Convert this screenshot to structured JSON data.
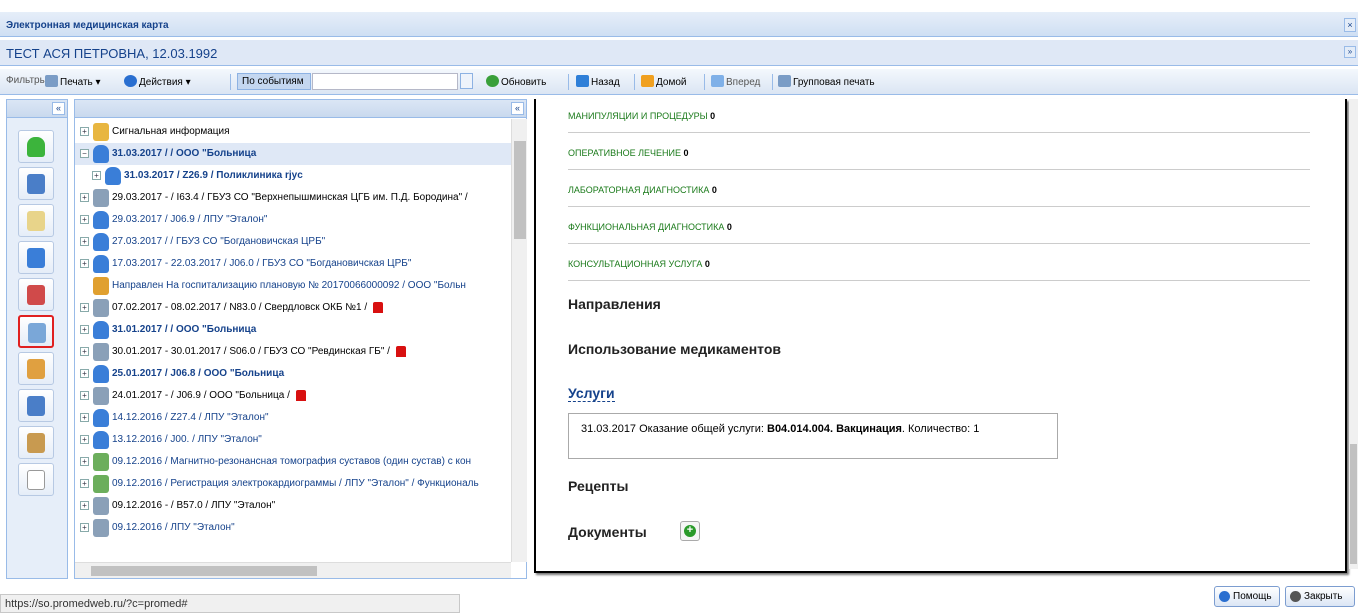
{
  "window": {
    "title": "Электронная медицинская карта",
    "close_glyph": "×"
  },
  "patient": {
    "name": "ТЕСТ АСЯ ПЕТРОВНА, 12.03.1992",
    "collapse_glyph": "»"
  },
  "toolbar": {
    "filters": "Фильтры",
    "print": "Печать ▾",
    "actions": "Действия ▾",
    "events": "По событиям",
    "search_value": "",
    "refresh": "Обновить",
    "back": "Назад",
    "home": "Домой",
    "forward": "Вперед",
    "group_print": "Групповая печать"
  },
  "leftbar": {
    "collapse_glyph": "«"
  },
  "tree": {
    "collapse_glyph": "«",
    "rows": [
      {
        "text": "Сигнальная информация",
        "style": "dark",
        "icon": "folder-info-icon",
        "color": "#e8b640"
      },
      {
        "text": "31.03.2017  /  / ООО \"Больница",
        "style": "bold",
        "icon": "person-icon",
        "color": "#3a7ed8",
        "selected": true,
        "expanded": true
      },
      {
        "text": "31.03.2017  / Z26.9  / Поликлиника rjyc",
        "style": "bold",
        "icon": "person-small-icon",
        "color": "#3a7ed8",
        "indent": true
      },
      {
        "text": "29.03.2017 - / I63.4 / ГБУЗ СО \"Верхнепышминская ЦГБ им. П.Д. Бородина\" /",
        "style": "dark",
        "icon": "ambulance-icon",
        "color": "#8aa0b8"
      },
      {
        "text": "29.03.2017  / J06.9  / ЛПУ \"Эталон\"",
        "style": "",
        "icon": "person-icon",
        "color": "#3a7ed8"
      },
      {
        "text": "27.03.2017  /  / ГБУЗ СО \"Богдановичская ЦРБ\"",
        "style": "",
        "icon": "person-icon",
        "color": "#3a7ed8"
      },
      {
        "text": "17.03.2017 - 22.03.2017  / J06.0  / ГБУЗ СО \"Богдановичская ЦРБ\"",
        "style": "",
        "icon": "person-icon",
        "color": "#3a7ed8"
      },
      {
        "text": "Направлен  На госпитализацию плановую  №  20170066000092  / ООО \"Больн",
        "style": "",
        "icon": "direction-icon",
        "color": "#e0a030",
        "nochild": true
      },
      {
        "text": "07.02.2017 - 08.02.2017 / N83.0 / Свердловск ОКБ №1 /",
        "style": "dark",
        "icon": "ambulance-icon",
        "color": "#8aa0b8",
        "flag": true
      },
      {
        "text": "31.01.2017  /  / ООО \"Больница",
        "style": "bold",
        "icon": "person-icon",
        "color": "#3a7ed8"
      },
      {
        "text": "30.01.2017 - 30.01.2017 / S06.0 / ГБУЗ СО \"Ревдинская ГБ\" /",
        "style": "dark",
        "icon": "ambulance-icon",
        "color": "#8aa0b8",
        "flag": true
      },
      {
        "text": "25.01.2017  / J06.8  / ООО \"Больница",
        "style": "bold",
        "icon": "person-icon",
        "color": "#3a7ed8"
      },
      {
        "text": "24.01.2017 - / J06.9 / ООО \"Больница /",
        "style": "dark",
        "icon": "ambulance-icon",
        "color": "#8aa0b8",
        "flag": true
      },
      {
        "text": "14.12.2016  / Z27.4  / ЛПУ \"Эталон\"",
        "style": "",
        "icon": "person-icon",
        "color": "#3a7ed8"
      },
      {
        "text": "13.12.2016  / J00.  / ЛПУ \"Эталон\"",
        "style": "",
        "icon": "person-icon",
        "color": "#3a7ed8"
      },
      {
        "text": "09.12.2016 / Магнитно-резонансная томография суставов (один сустав) с кон",
        "style": "",
        "icon": "document-icon",
        "color": "#6cae5c"
      },
      {
        "text": "09.12.2016 / Регистрация электрокардиограммы  / ЛПУ \"Эталон\" / Функциональ",
        "style": "",
        "icon": "document-icon",
        "color": "#6cae5c"
      },
      {
        "text": "09.12.2016 - / B57.0 / ЛПУ \"Эталон\"",
        "style": "dark",
        "icon": "ambulance-icon",
        "color": "#8aa0b8"
      },
      {
        "text": "09.12.2016  /  ЛПУ \"Эталон\"",
        "style": "",
        "icon": "ambulance-icon",
        "color": "#8aa0b8"
      }
    ]
  },
  "content": {
    "services": [
      {
        "label": "МАНИПУЛЯЦИИ И ПРОЦЕДУРЫ",
        "count": "0"
      },
      {
        "label": "ОПЕРАТИВНОЕ ЛЕЧЕНИЕ",
        "count": "0"
      },
      {
        "label": "ЛАБОРАТОРНАЯ ДИАГНОСТИКА",
        "count": "0"
      },
      {
        "label": "ФУНКЦИОНАЛЬНАЯ ДИАГНОСТИКА",
        "count": "0"
      },
      {
        "label": "КОНСУЛЬТАЦИОННАЯ УСЛУГА",
        "count": "0"
      }
    ],
    "directions": "Направления",
    "medications": "Использование медикаментов",
    "services_title": "Услуги",
    "service_item": {
      "prefix": "31.03.2017 Оказание общей услуги: ",
      "code": "B04.014.004. Вакцинация",
      "suffix": ". Количество: 1"
    },
    "prescriptions": "Рецепты",
    "documents": "Документы",
    "add_glyph": "+"
  },
  "status": {
    "url": "https://so.promedweb.ru/?c=promed#"
  },
  "footer": {
    "help": "Помощь",
    "close": "Закрыть"
  },
  "colors": {
    "accent": "#15428b",
    "green_link": "#1a7a1a",
    "panel_bg": "#dfe8f6",
    "highlight": "#e02020"
  }
}
